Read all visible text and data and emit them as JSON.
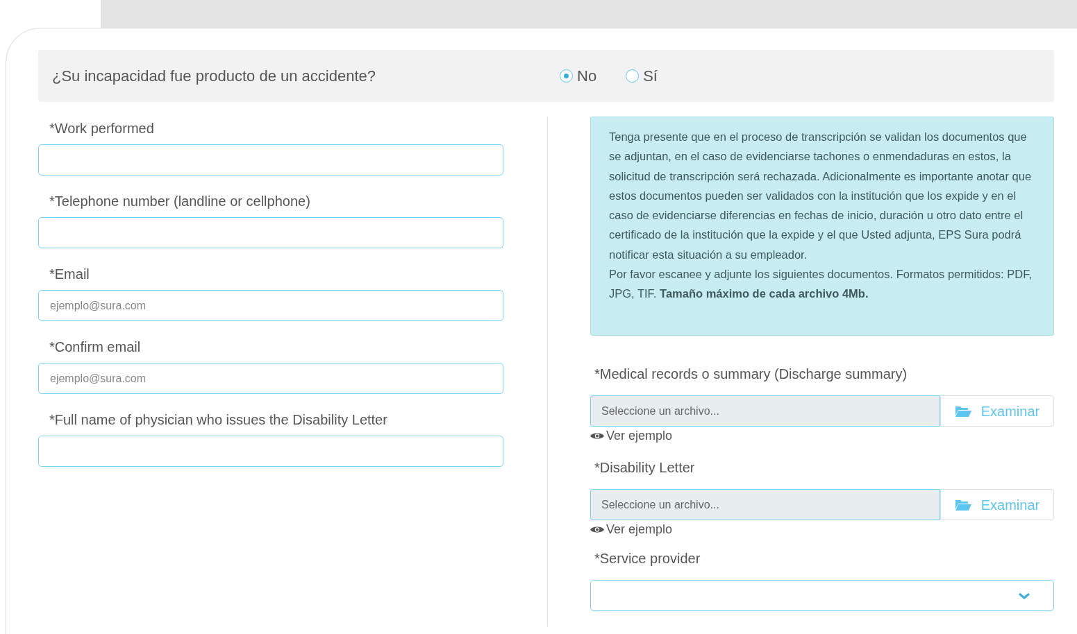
{
  "question": {
    "text": "¿Su incapacidad fue producto de un accidente?",
    "options": [
      {
        "label": "No",
        "selected": true
      },
      {
        "label": "Sí",
        "selected": false
      }
    ]
  },
  "left_fields": [
    {
      "label": "*Work performed"
    },
    {
      "label": "*Telephone number (landline or cellphone)"
    },
    {
      "label": "*Email",
      "placeholder": "ejemplo@sura.com"
    },
    {
      "label": "*Confirm email",
      "placeholder": "ejemplo@sura.com"
    },
    {
      "label": "*Full name of physician who issues the Disability Letter"
    }
  ],
  "notice": {
    "paragraphs": [
      "Tenga presente que en el proceso de transcripción se validan los documentos que se adjuntan, en el caso de evidenciarse tachones o enmendaduras en estos, la solicitud de transcripción será rechazada. Adicionalmente es importante anotar que estos documentos pueden ser validados con la institución que los expide y en el caso de evidenciarse diferencias en fechas de inicio, duración u otro dato entre el certificado de la institución que la expide y el que Usted adjunta, EPS Sura podrá notificar esta situación a su empleador.",
      "Por favor escanee y adjunte los siguientes documentos. Formatos permitidos: PDF, JPG, TIF. **Tamaño máximo de cada archivo 4Mb.**"
    ]
  },
  "uploads": [
    {
      "label": "*Medical records o summary (Discharge summary)",
      "placeholder": "Seleccione un archivo...",
      "button": "Examinar",
      "example_link": "Ver ejemplo"
    },
    {
      "label": "*Disability Letter",
      "placeholder": "Seleccione un archivo...",
      "button": "Examinar",
      "example_link": "Ver ejemplo"
    }
  ],
  "service_provider": {
    "label": "*Service provider"
  }
}
